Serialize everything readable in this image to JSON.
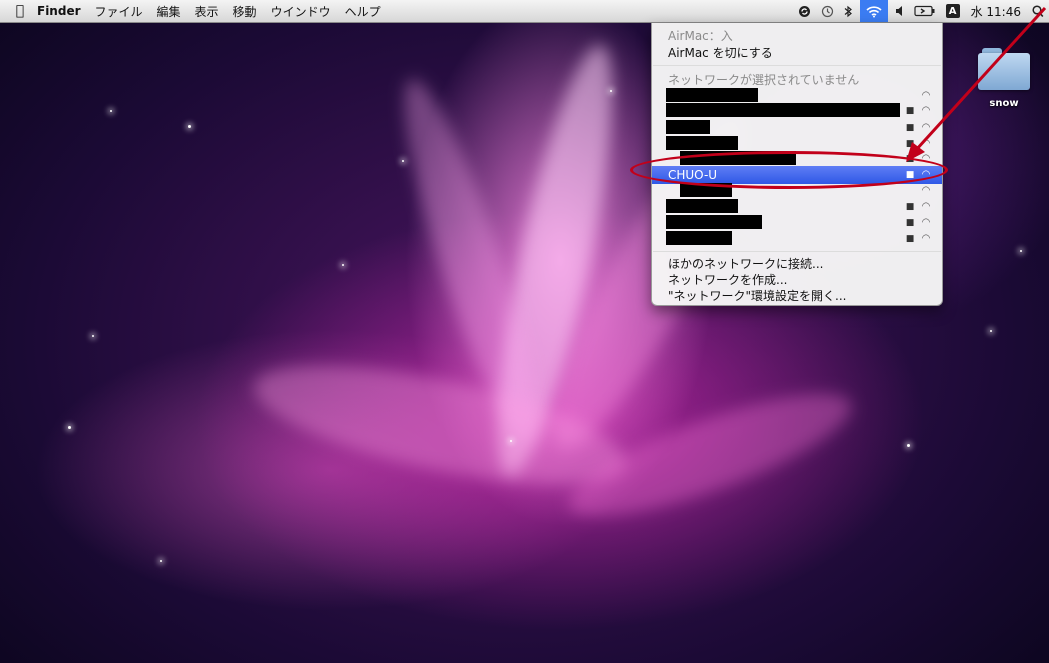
{
  "menubar": {
    "apple_icon": "apple-logo-icon",
    "app_name": "Finder",
    "items": [
      "ファイル",
      "編集",
      "表示",
      "移動",
      "ウインドウ",
      "ヘルプ"
    ],
    "status": {
      "icons": [
        "sync-icon",
        "time-machine-icon",
        "bluetooth-icon",
        "wifi-icon",
        "volume-icon",
        "battery-icon",
        "input-method-icon"
      ],
      "input_badge": "A",
      "clock": "水 11:46",
      "spotlight": "Q"
    }
  },
  "airport_menu": {
    "status_line": "AirMac：入",
    "toggle": "AirMac を切にする",
    "no_network": "ネットワークが選択されていません",
    "selected_network": "CHUO-U",
    "networks_redacted_count": 9,
    "actions": [
      "ほかのネットワークに接続...",
      "ネットワークを作成...",
      "\"ネットワーク\"環境設定を開く..."
    ],
    "highlight_color": "#3b64ee"
  },
  "desktop": {
    "icon_label": "snow",
    "icon_type": "folder-icon"
  },
  "annotation": {
    "color": "#c2001a"
  }
}
